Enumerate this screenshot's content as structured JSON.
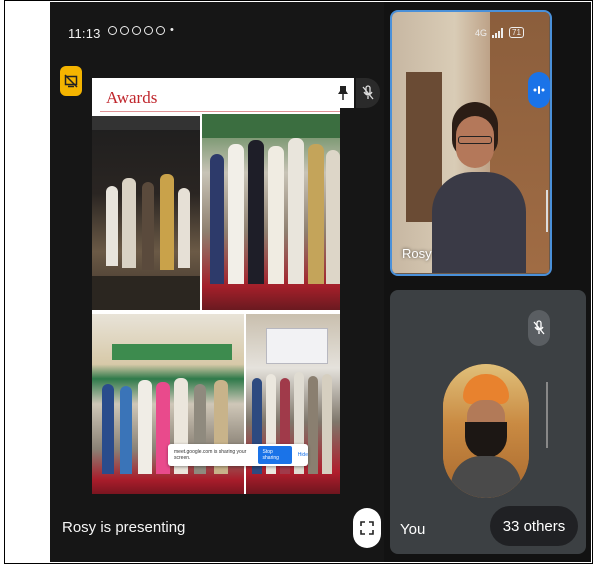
{
  "status_bar": {
    "time": "11:13",
    "notification_dot": "•",
    "network": "4G",
    "battery": "71"
  },
  "slide": {
    "title": "Awards"
  },
  "share_banner": {
    "text": "meet.google.com is sharing your screen.",
    "stop_label": "Stop sharing",
    "hide_label": "Hide"
  },
  "presenter": {
    "caption": "Rosy is presenting"
  },
  "participants": [
    {
      "name": "Rosy"
    },
    {
      "name": "You"
    }
  ],
  "others_count_label": "33 others",
  "colors": {
    "accent_blue": "#1a73e8",
    "tile_border": "#4a90d9",
    "badge_yellow": "#f4b400",
    "slide_title_red": "#c0272d"
  },
  "icons": [
    "screen-share-off-icon",
    "pin-icon",
    "mic-off-icon",
    "fullscreen-icon",
    "voice-active-icon"
  ]
}
